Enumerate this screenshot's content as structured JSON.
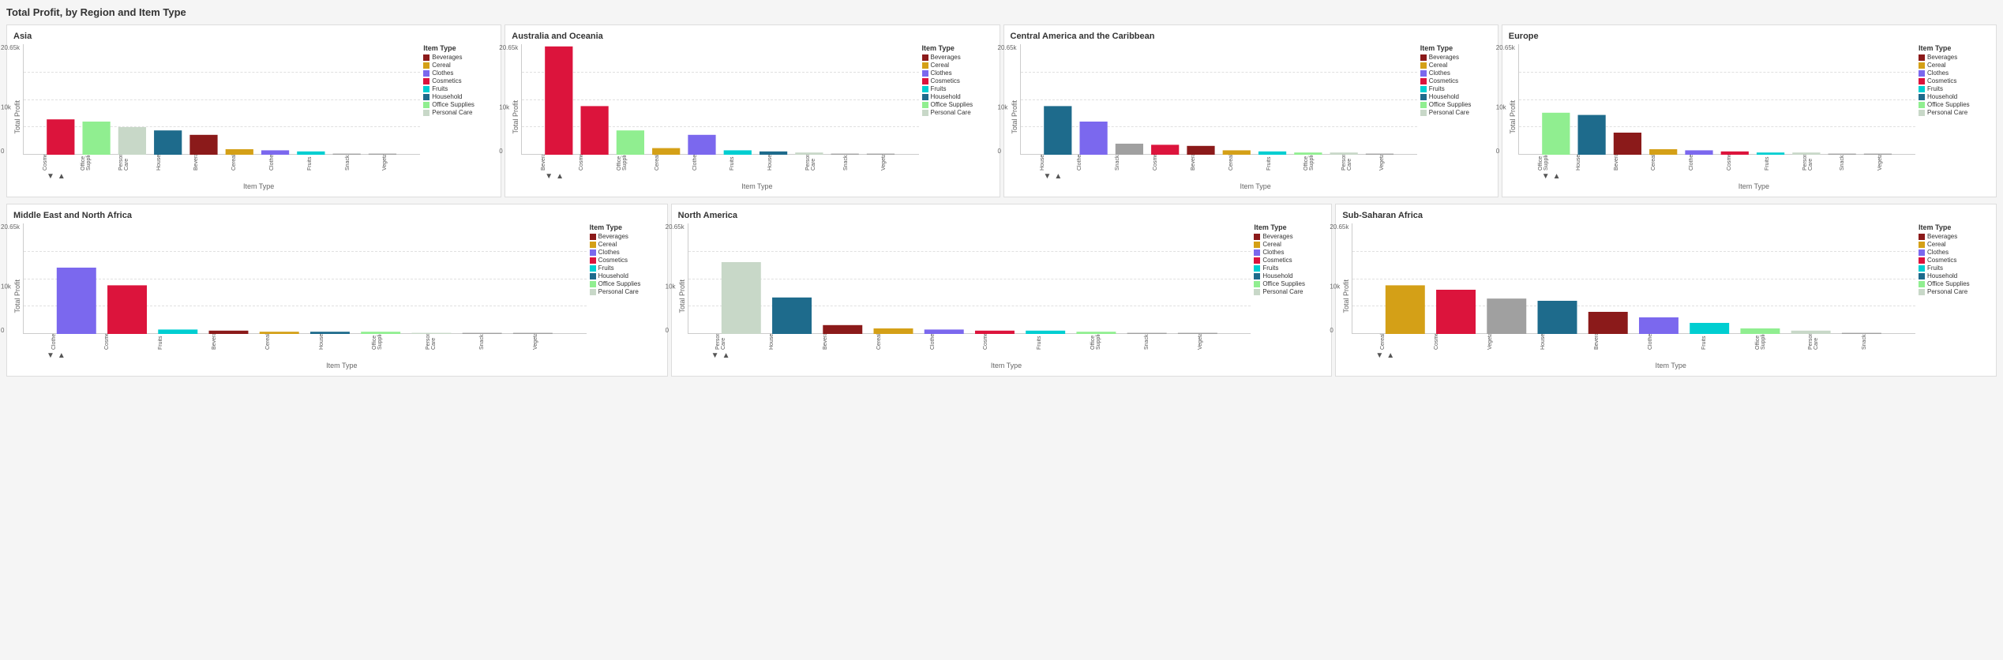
{
  "pageTitle": "Total Profit, by Region and Item Type",
  "colors": {
    "Beverages": "#8B1A1A",
    "Cereal": "#D4A017",
    "Clothes": "#7B68EE",
    "Cosmetics": "#DC143C",
    "Fruits": "#00CED1",
    "Household": "#1E6B8C",
    "Office Supplies": "#90EE90",
    "Personal Care": "#C8D8C8",
    "Snacks": "#A0A0A0",
    "Vegetables": "#A0A0A0"
  },
  "yAxisLabel": "Total Profit",
  "xAxisLabel": "Item Type",
  "maxValue": "20.65k",
  "midValue": "10k",
  "legendTitle": "Item Type",
  "legendItems": [
    "Beverages",
    "Cereal",
    "Clothes",
    "Cosmetics",
    "Fruits",
    "Household",
    "Office Supplies",
    "Personal Care"
  ],
  "regions": [
    {
      "name": "Asia",
      "bars": [
        {
          "label": "Cosmetics",
          "value": 0.32,
          "color": "#DC143C"
        },
        {
          "label": "Office Supplies",
          "value": 0.3,
          "color": "#90EE90"
        },
        {
          "label": "Personal Care",
          "value": 0.25,
          "color": "#C8D8C8"
        },
        {
          "label": "Household",
          "value": 0.22,
          "color": "#1E6B8C"
        },
        {
          "label": "Beverages",
          "value": 0.18,
          "color": "#8B1A1A"
        },
        {
          "label": "Cereal",
          "value": 0.05,
          "color": "#D4A017"
        },
        {
          "label": "Clothes",
          "value": 0.04,
          "color": "#7B68EE"
        },
        {
          "label": "Fruits",
          "value": 0.03,
          "color": "#00CED1"
        },
        {
          "label": "Snacks",
          "value": 0.01,
          "color": "#A0A0A0"
        },
        {
          "label": "Vegetables",
          "value": 0.01,
          "color": "#A0A0A0"
        }
      ]
    },
    {
      "name": "Australia and Oceania",
      "bars": [
        {
          "label": "Beverages",
          "value": 0.98,
          "color": "#DC143C"
        },
        {
          "label": "Cosmetics",
          "value": 0.44,
          "color": "#DC143C"
        },
        {
          "label": "Office Supplies",
          "value": 0.22,
          "color": "#90EE90"
        },
        {
          "label": "Cereal",
          "value": 0.06,
          "color": "#D4A017"
        },
        {
          "label": "Clothes",
          "value": 0.18,
          "color": "#7B68EE"
        },
        {
          "label": "Fruits",
          "value": 0.04,
          "color": "#00CED1"
        },
        {
          "label": "Household",
          "value": 0.03,
          "color": "#1E6B8C"
        },
        {
          "label": "Personal Care",
          "value": 0.02,
          "color": "#C8D8C8"
        },
        {
          "label": "Snacks",
          "value": 0.01,
          "color": "#A0A0A0"
        },
        {
          "label": "Vegetables",
          "value": 0.01,
          "color": "#A0A0A0"
        }
      ]
    },
    {
      "name": "Central America and the Caribbean",
      "bars": [
        {
          "label": "Household",
          "value": 0.44,
          "color": "#1E6B8C"
        },
        {
          "label": "Clothes",
          "value": 0.3,
          "color": "#7B68EE"
        },
        {
          "label": "Snacks",
          "value": 0.1,
          "color": "#A0A0A0"
        },
        {
          "label": "Cosmetics",
          "value": 0.09,
          "color": "#DC143C"
        },
        {
          "label": "Beverages",
          "value": 0.08,
          "color": "#8B1A1A"
        },
        {
          "label": "Cereal",
          "value": 0.04,
          "color": "#D4A017"
        },
        {
          "label": "Fruits",
          "value": 0.03,
          "color": "#00CED1"
        },
        {
          "label": "Office Supplies",
          "value": 0.02,
          "color": "#90EE90"
        },
        {
          "label": "Personal Care",
          "value": 0.02,
          "color": "#C8D8C8"
        },
        {
          "label": "Vegetables",
          "value": 0.01,
          "color": "#A0A0A0"
        }
      ]
    },
    {
      "name": "Europe",
      "bars": [
        {
          "label": "Office Supplies",
          "value": 0.38,
          "color": "#90EE90"
        },
        {
          "label": "Household",
          "value": 0.36,
          "color": "#1E6B8C"
        },
        {
          "label": "Beverages",
          "value": 0.2,
          "color": "#8B1A1A"
        },
        {
          "label": "Cereal",
          "value": 0.05,
          "color": "#D4A017"
        },
        {
          "label": "Clothes",
          "value": 0.04,
          "color": "#7B68EE"
        },
        {
          "label": "Cosmetics",
          "value": 0.03,
          "color": "#DC143C"
        },
        {
          "label": "Fruits",
          "value": 0.02,
          "color": "#00CED1"
        },
        {
          "label": "Personal Care",
          "value": 0.02,
          "color": "#C8D8C8"
        },
        {
          "label": "Snacks",
          "value": 0.01,
          "color": "#A0A0A0"
        },
        {
          "label": "Vegetables",
          "value": 0.01,
          "color": "#A0A0A0"
        }
      ]
    },
    {
      "name": "Middle East and North Africa",
      "bars": [
        {
          "label": "Clothes",
          "value": 0.6,
          "color": "#7B68EE"
        },
        {
          "label": "Cosmetics",
          "value": 0.44,
          "color": "#DC143C"
        },
        {
          "label": "Fruits",
          "value": 0.04,
          "color": "#00CED1"
        },
        {
          "label": "Beverages",
          "value": 0.03,
          "color": "#8B1A1A"
        },
        {
          "label": "Cereal",
          "value": 0.02,
          "color": "#D4A017"
        },
        {
          "label": "Household",
          "value": 0.02,
          "color": "#1E6B8C"
        },
        {
          "label": "Office Supplies",
          "value": 0.02,
          "color": "#90EE90"
        },
        {
          "label": "Personal Care",
          "value": 0.01,
          "color": "#C8D8C8"
        },
        {
          "label": "Snacks",
          "value": 0.01,
          "color": "#A0A0A0"
        },
        {
          "label": "Vegetables",
          "value": 0.01,
          "color": "#A0A0A0"
        }
      ]
    },
    {
      "name": "North America",
      "bars": [
        {
          "label": "Personal Care",
          "value": 0.65,
          "color": "#C8D8C8"
        },
        {
          "label": "Household",
          "value": 0.33,
          "color": "#1E6B8C"
        },
        {
          "label": "Beverages",
          "value": 0.08,
          "color": "#8B1A1A"
        },
        {
          "label": "Cereal",
          "value": 0.05,
          "color": "#D4A017"
        },
        {
          "label": "Clothes",
          "value": 0.04,
          "color": "#7B68EE"
        },
        {
          "label": "Cosmetics",
          "value": 0.03,
          "color": "#DC143C"
        },
        {
          "label": "Fruits",
          "value": 0.03,
          "color": "#00CED1"
        },
        {
          "label": "Office Supplies",
          "value": 0.02,
          "color": "#90EE90"
        },
        {
          "label": "Snacks",
          "value": 0.01,
          "color": "#A0A0A0"
        },
        {
          "label": "Vegetables",
          "value": 0.01,
          "color": "#A0A0A0"
        }
      ]
    },
    {
      "name": "Sub-Saharan Africa",
      "bars": [
        {
          "label": "Cereal",
          "value": 0.44,
          "color": "#D4A017"
        },
        {
          "label": "Cosmetics",
          "value": 0.4,
          "color": "#DC143C"
        },
        {
          "label": "Vegetables",
          "value": 0.32,
          "color": "#A0A0A0"
        },
        {
          "label": "Household",
          "value": 0.3,
          "color": "#1E6B8C"
        },
        {
          "label": "Beverages",
          "value": 0.2,
          "color": "#8B1A1A"
        },
        {
          "label": "Clothes",
          "value": 0.15,
          "color": "#7B68EE"
        },
        {
          "label": "Fruits",
          "value": 0.1,
          "color": "#00CED1"
        },
        {
          "label": "Office Supplies",
          "value": 0.05,
          "color": "#90EE90"
        },
        {
          "label": "Personal Care",
          "value": 0.03,
          "color": "#C8D8C8"
        },
        {
          "label": "Snacks",
          "value": 0.01,
          "color": "#A0A0A0"
        }
      ]
    }
  ]
}
